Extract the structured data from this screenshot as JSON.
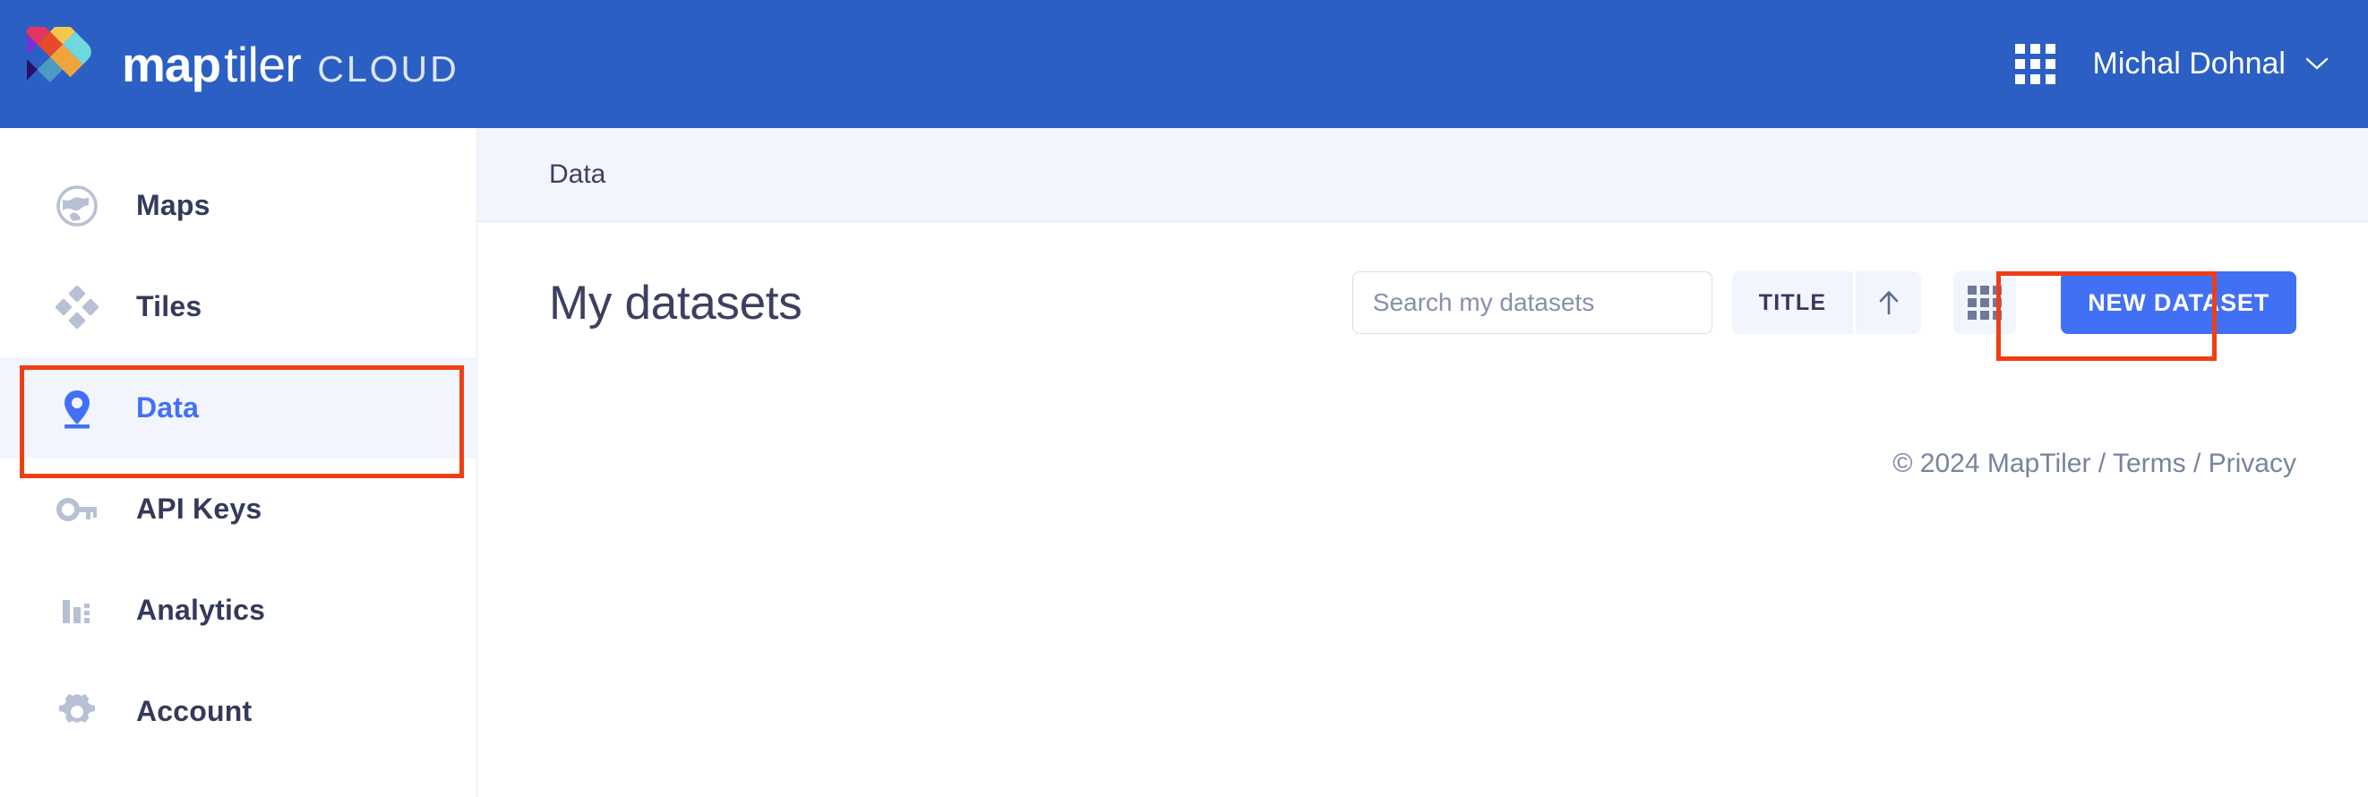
{
  "header": {
    "brand": {
      "map": "map",
      "tiler": "tiler",
      "cloud": "CLOUD"
    },
    "apps_icon": "apps-grid-icon",
    "user": {
      "name": "Michal Dohnal",
      "chevron": "chevron-down-icon"
    },
    "bg_color": "#2B5FC4"
  },
  "sidebar": {
    "items": [
      {
        "label": "Maps",
        "icon": "globe-icon",
        "active": false
      },
      {
        "label": "Tiles",
        "icon": "tiles-icon",
        "active": false
      },
      {
        "label": "Data",
        "icon": "map-pin-icon",
        "active": true
      },
      {
        "label": "API Keys",
        "icon": "key-icon",
        "active": false
      },
      {
        "label": "Analytics",
        "icon": "bar-chart-icon",
        "active": false
      },
      {
        "label": "Account",
        "icon": "gear-icon",
        "active": false
      }
    ],
    "active_color": "#4270F4",
    "active_bg": "#F2F5FD",
    "inactive_color": "#343A5B"
  },
  "main": {
    "breadcrumb": "Data",
    "title": "My datasets",
    "search": {
      "value": "",
      "placeholder": "Search my datasets"
    },
    "sort": {
      "field_label": "TITLE",
      "direction_icon": "arrow-up-icon"
    },
    "view_toggle_icon": "grid-view-icon",
    "new_dataset_label": "NEW DATASET",
    "new_dataset_color": "#4270F4"
  },
  "footer": {
    "copyright": "© 2024 MapTiler",
    "sep1": "/",
    "terms": "Terms",
    "sep2": "/",
    "privacy": "Privacy"
  },
  "annotations": {
    "color": "#EF3E16",
    "boxes": [
      {
        "target": "sidebar-item-data"
      },
      {
        "target": "new-dataset-button"
      }
    ]
  }
}
